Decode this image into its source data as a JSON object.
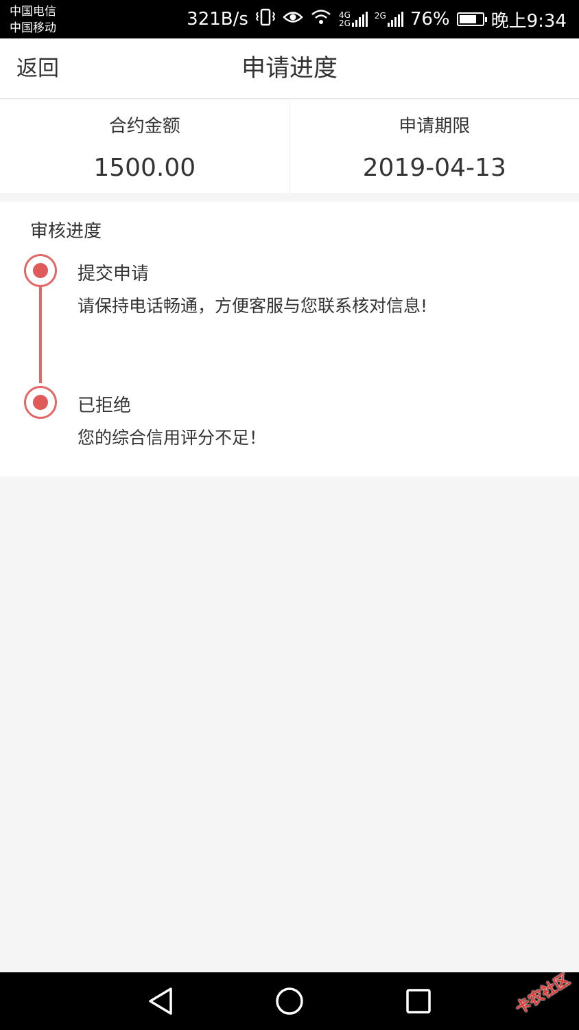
{
  "status_bar": {
    "carrier_1": "中国电信",
    "carrier_2": "中国移动",
    "net_speed": "321B/s",
    "net_type_1": "4G",
    "net_type_2": "2G",
    "net_type_3": "2G",
    "battery": "76%",
    "battery_level": 0.76,
    "time": "晚上9:34"
  },
  "header": {
    "back_label": "返回",
    "title": "申请进度"
  },
  "summary": {
    "amount_label": "合约金额",
    "amount_value": "1500.00",
    "period_label": "申请期限",
    "period_value": "2019-04-13"
  },
  "progress": {
    "title": "审核进度",
    "steps": [
      {
        "title": "提交申请",
        "desc": "请保持电话畅通，方便客服与您联系核对信息!"
      },
      {
        "title": "已拒绝",
        "desc": "您的综合信用评分不足！"
      }
    ]
  },
  "nav": {
    "icons": [
      "back-triangle-icon",
      "home-circle-icon",
      "recents-square-icon"
    ]
  },
  "watermark": "卡农社区",
  "colors": {
    "accent": "#e05a5a",
    "background": "#f5f5f5",
    "bar": "#000000"
  }
}
